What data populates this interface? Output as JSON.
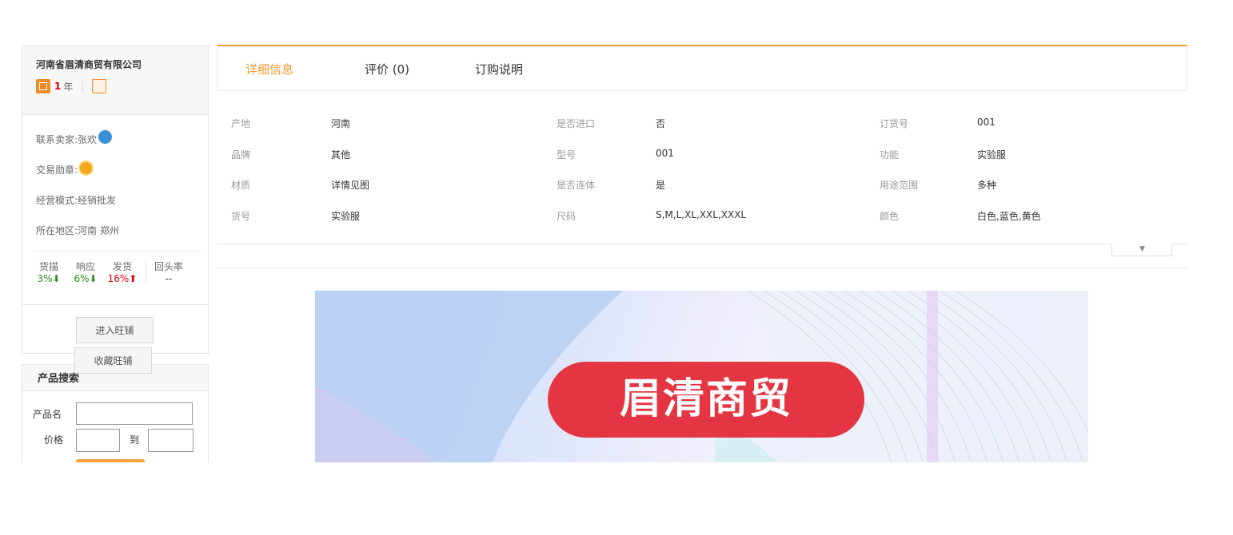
{
  "sidebar": {
    "company": "河南省眉清商贸有限公司",
    "years_number": "1",
    "years_unit": "年",
    "info": [
      {
        "label": "联系卖家:",
        "value": "张欢"
      },
      {
        "label": "交易勋章:",
        "value": ""
      },
      {
        "label": "经营模式:",
        "value": "经销批发"
      },
      {
        "label": "所在地区:",
        "value": "河南 郑州"
      }
    ],
    "stats": [
      {
        "label": "货描",
        "value": "3%",
        "trend": "down"
      },
      {
        "label": "响应",
        "value": "6%",
        "trend": "down"
      },
      {
        "label": "发货",
        "value": "16%",
        "trend": "up"
      },
      {
        "label": "回头率",
        "value": "--",
        "trend": "none"
      }
    ],
    "enter_shop_label": "进入旺铺",
    "favorite_shop_label": "收藏旺铺"
  },
  "product_search": {
    "title": "产品搜索",
    "name_label": "产品名",
    "price_label": "价格",
    "to_label": "到"
  },
  "tabs": [
    {
      "label": "详细信息",
      "active": true
    },
    {
      "label": "评价 (0)",
      "active": false
    },
    {
      "label": "订购说明",
      "active": false
    }
  ],
  "attributes": [
    {
      "key": "产地",
      "value": "河南"
    },
    {
      "key": "是否进口",
      "value": "否"
    },
    {
      "key": "订货号",
      "value": "001"
    },
    {
      "key": "品牌",
      "value": "其他"
    },
    {
      "key": "型号",
      "value": "001"
    },
    {
      "key": "功能",
      "value": "实验服"
    },
    {
      "key": "材质",
      "value": "详情见图"
    },
    {
      "key": "是否连体",
      "value": "是"
    },
    {
      "key": "用途范围",
      "value": "多种"
    },
    {
      "key": "货号",
      "value": "实验服"
    },
    {
      "key": "尺码",
      "value": "S,M,L,XL,XXL,XXXL"
    },
    {
      "key": "颜色",
      "value": "白色,蓝色,黄色"
    }
  ],
  "banner": {
    "title": "眉清商贸"
  },
  "colors": {
    "accent": "#f29a2e",
    "banner_pill": "#e43642",
    "trend_down": "#2e8b1f",
    "trend_up": "#e60012"
  }
}
